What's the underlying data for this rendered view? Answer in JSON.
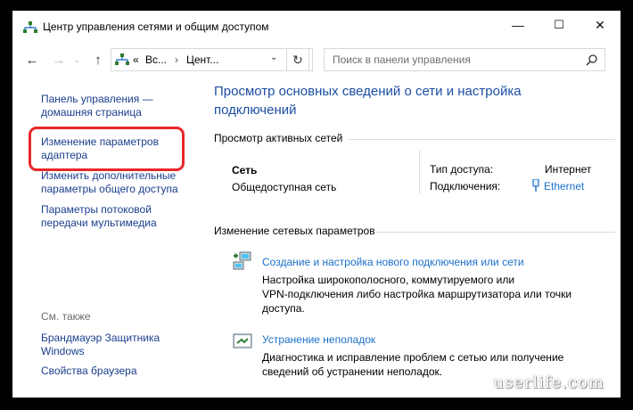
{
  "window": {
    "title": "Центр управления сетями и общим доступом",
    "controls": {
      "minimize": "—",
      "maximize": "☐",
      "close": "✕"
    }
  },
  "nav": {
    "back": "←",
    "forward": "→",
    "up": "↑",
    "address": {
      "chevron": "«",
      "crumbs": [
        "Вс...",
        "Цент..."
      ],
      "separator": "›",
      "dropdown": "⌄"
    },
    "refresh": "↻",
    "search": {
      "placeholder": "Поиск в панели управления"
    }
  },
  "sidebar": {
    "home_link": [
      "Панель управления —",
      "домашняя страница"
    ],
    "adapter_link": [
      "Изменение параметров",
      "адаптера"
    ],
    "sharing_link": [
      "Изменить дополнительные",
      "параметры общего доступа"
    ],
    "streaming_link": [
      "Параметры потоковой",
      "передачи мультимедиа"
    ],
    "see_also": "См. также",
    "firewall_link": [
      "Брандмауэр Защитника",
      "Windows"
    ],
    "browser_link": "Свойства браузера"
  },
  "main": {
    "heading": [
      "Просмотр основных сведений о сети и настройка",
      "подключений"
    ],
    "active_section": "Просмотр активных сетей",
    "network": {
      "name": "Сеть",
      "type": "Общедоступная сеть",
      "access_label": "Тип доступа:",
      "access_value": "Интернет",
      "connections_label": "Подключения:",
      "connection_value": "Ethernet"
    },
    "change_section": "Изменение сетевых параметров",
    "tasks": [
      {
        "title": "Создание и настройка нового подключения или сети",
        "desc": [
          "Настройка широкополосного, коммутируемого или",
          "VPN-подключения либо настройка маршрутизатора или точки",
          "доступа."
        ]
      },
      {
        "title": "Устранение неполадок",
        "desc": [
          "Диагностика и исправление проблем с сетью или получение",
          "сведений об устранении неполадок."
        ]
      }
    ]
  },
  "watermark": "userlife.com",
  "colors": {
    "link": "#1a3e8c",
    "heading": "#1c4ea3",
    "highlight": "#e8262a"
  }
}
